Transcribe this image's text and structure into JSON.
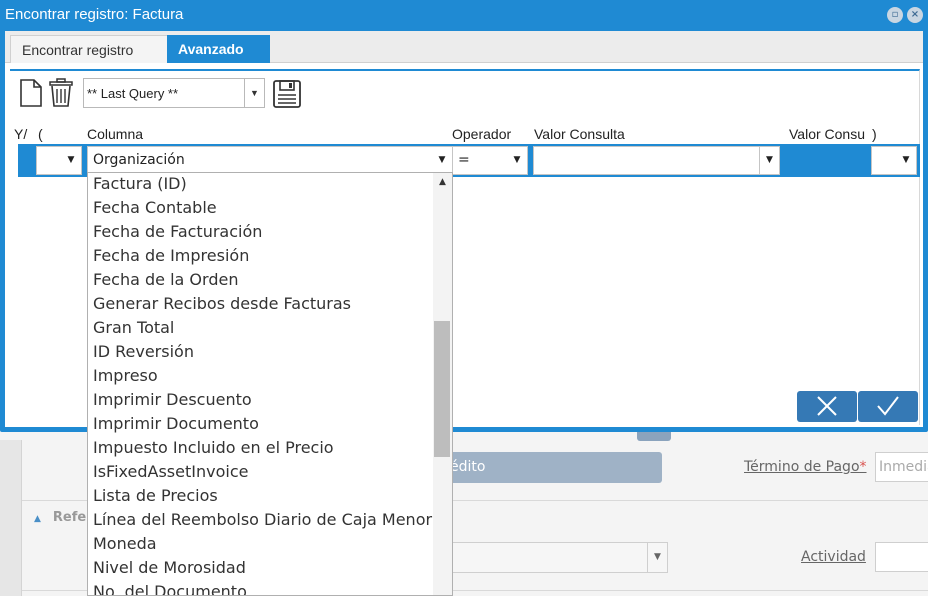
{
  "window": {
    "title": "Encontrar registro: Factura"
  },
  "tabs": [
    {
      "label": "Encontrar registro",
      "active": false
    },
    {
      "label": "Avanzado",
      "active": true
    }
  ],
  "toolbar": {
    "new_icon": "new-document-icon",
    "delete_icon": "trash-icon",
    "query_value": "** Last Query **",
    "save_icon": "save-icon"
  },
  "columns": {
    "and_or": "Y/",
    "paren_open": "(",
    "column": "Columna",
    "operator": "Operador",
    "value": "Valor Consulta",
    "value_to": "Valor Consu",
    "paren_close": ")"
  },
  "row": {
    "and_or": "",
    "column": "Organización",
    "operator": "=",
    "value": "",
    "paren_close": ""
  },
  "dropdown_items": [
    "Factura (ID)",
    "Fecha Contable",
    "Fecha de Facturación",
    "Fecha de Impresión",
    "Fecha de la Orden",
    "Generar Recibos desde Facturas",
    "Gran Total",
    "ID Reversión",
    "Impreso",
    "Imprimir Descuento",
    "Imprimir Documento",
    "Impuesto Incluido en el Precio",
    "IsFixedAssetInvoice",
    "Lista de Precios",
    "Línea del Reembolso Diario de Caja Menor",
    "Moneda",
    "Nivel de Morosidad",
    "No. del Documento"
  ],
  "actions": {
    "cancel_icon": "close-icon",
    "ok_icon": "check-icon"
  },
  "background": {
    "credit_button": "édito",
    "payment_term_label": "Término de Pago",
    "payment_term_value": "Inmedia",
    "group_label": "Refe",
    "activity_label": "Actividad"
  },
  "colors": {
    "accent": "#1f8ad3",
    "button": "#3579b5"
  }
}
